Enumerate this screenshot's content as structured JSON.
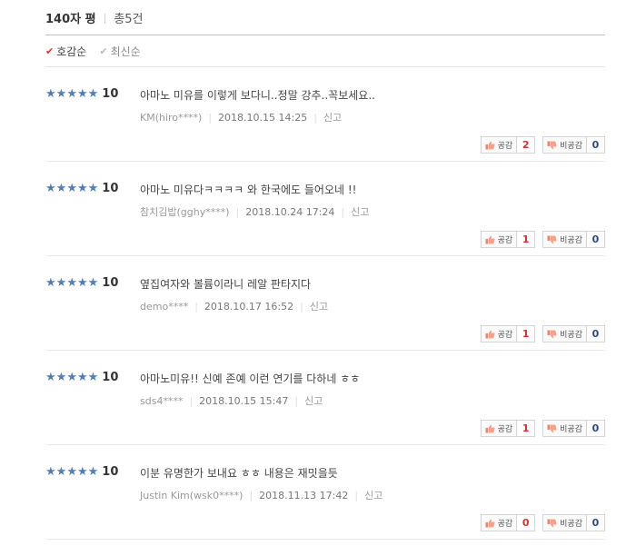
{
  "header": {
    "title": "140자 평",
    "separator": "|",
    "total": "총5건"
  },
  "sort": [
    {
      "label": "호감순",
      "active": true
    },
    {
      "label": "최신순",
      "active": false
    }
  ],
  "labels": {
    "like": "공감",
    "dislike": "비공감",
    "report": "신고",
    "star": "★",
    "separator": "|"
  },
  "reviews": [
    {
      "score": "10",
      "comment": "아마노 미유를 이렇게 보다니..정말 강추..꼭보세요..",
      "user": "KM(hiro****)",
      "date": "2018.10.15 14:25",
      "likes": "2",
      "dislikes": "0"
    },
    {
      "score": "10",
      "comment": "아마노 미유다ㅋㅋㅋㅋ 와 한국에도 들어오네 !!",
      "user": "참치김밥(gghy****)",
      "date": "2018.10.24 17:24",
      "likes": "1",
      "dislikes": "0"
    },
    {
      "score": "10",
      "comment": "옆집여자와 볼륨이라니 레알 판타지다",
      "user": "demo****",
      "date": "2018.10.17 16:52",
      "likes": "1",
      "dislikes": "0"
    },
    {
      "score": "10",
      "comment": "아마노미유!! 신예 존예 이런 연기를 다하네 ㅎㅎ",
      "user": "sds4****",
      "date": "2018.10.15 15:47",
      "likes": "1",
      "dislikes": "0"
    },
    {
      "score": "10",
      "comment": "이분 유명한가 보내요 ㅎㅎ 내용은 재밋을듯",
      "user": "Justin Kim(wsk0****)",
      "date": "2018.11.13 17:42",
      "likes": "0",
      "dislikes": "0"
    }
  ]
}
